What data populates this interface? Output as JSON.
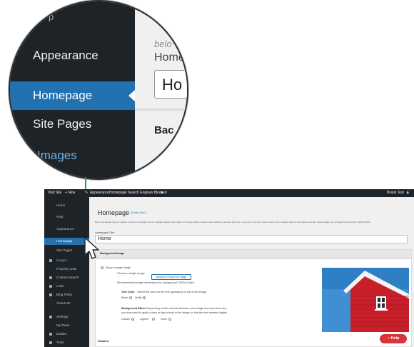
{
  "zoom": {
    "top_fragment": "p",
    "items": [
      "Appearance",
      "Homepage",
      "Site Pages",
      "Images"
    ],
    "sub_fragment": "belo",
    "label_fragment": "Home",
    "input_fragment": "Ho",
    "back_fragment": "Bac"
  },
  "admin_bar": {
    "visit_site": "Visit Site",
    "new": "+ New",
    "appearance": "Appearance",
    "homepage": "Homepage",
    "seo": "Search Engines Blocked",
    "user": "Brand Test"
  },
  "sidebar": {
    "items": [
      {
        "label": "Home",
        "style": "plain"
      },
      {
        "label": "Help",
        "style": "plain"
      },
      {
        "label": "Appearance",
        "style": "plain"
      },
      {
        "label": "Homepage",
        "style": "active"
      },
      {
        "label": "Site Pages",
        "style": "plain"
      },
      {
        "label": "Images",
        "style": "highlight"
      },
      {
        "label": "Property Lists",
        "style": "plain"
      },
      {
        "label": "Custom Search",
        "style": "plain"
      },
      {
        "label": "Links",
        "style": "plain"
      },
      {
        "label": "Blog Posts",
        "style": "plain"
      },
      {
        "label": "About Me",
        "style": "plain"
      },
      {
        "label": "Settings",
        "style": "plain"
      },
      {
        "label": "My Team",
        "style": "plain"
      },
      {
        "label": "Builder",
        "style": "plain"
      },
      {
        "label": "Tools",
        "style": "plain"
      }
    ]
  },
  "page": {
    "title": "Homepage",
    "whats_this": "(What's this?)",
    "description": "Every homepage layout contains a variety of modules. Some modules display information or images, while modules allow visitors to interact with you or your site. For your chosen layout, the modules that can be edited are listed below. Make your changes here and then click Publish!",
    "field_label": "Homepage Title:",
    "field_value": "Home"
  },
  "background": {
    "panel_title": "Background Image",
    "show_single": "Show a single image",
    "choose_single": "Choose a single image:",
    "upload_button": "Upload or Choose an Image",
    "recommended": "Recommended image dimensions for background: 2200x1100px",
    "text_color_label": "Text Color",
    "text_color_help": "- Select the color for the text appearing on top of the image.",
    "black": "Black",
    "white": "White",
    "effect_label": "Background Effect",
    "effect_help_1": "- Depending on the contrast between your image and your text color",
    "effect_help_2": "you may need to apply a dark or light shade to the image so that the text remains legible.",
    "darken": "Darken",
    "lighten": "Lighten",
    "none": "None",
    "headline": "Headline"
  },
  "help_button": "Help",
  "colors": {
    "accent": "#2271b1",
    "sidebar": "#1d2327",
    "arrow": "#14a83a",
    "help": "#d63638"
  }
}
